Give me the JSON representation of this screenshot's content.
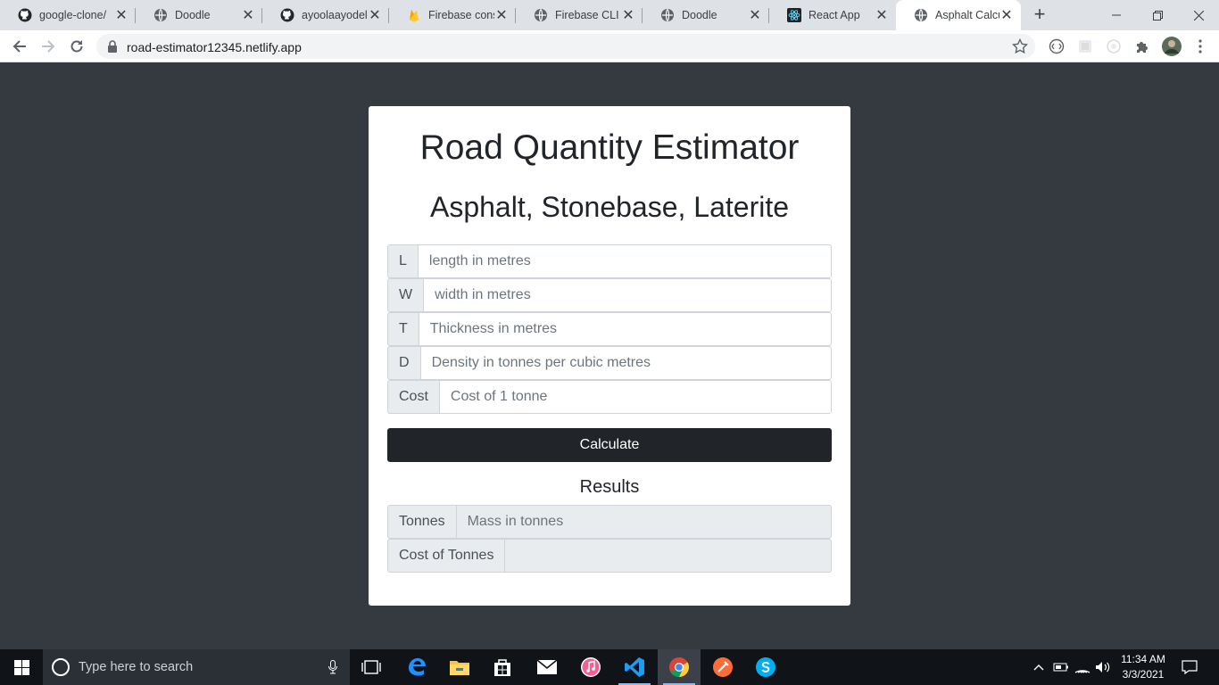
{
  "browser": {
    "tabs": [
      {
        "title": "google-clone/",
        "icon": "github-icon",
        "active": false
      },
      {
        "title": "Doodle",
        "icon": "globe-icon",
        "active": false
      },
      {
        "title": "ayoolaayodele",
        "icon": "github-icon",
        "active": false
      },
      {
        "title": "Firebase conso",
        "icon": "firebase-icon",
        "active": false
      },
      {
        "title": "Firebase CLI",
        "icon": "globe-icon",
        "active": false
      },
      {
        "title": "Doodle",
        "icon": "globe-icon",
        "active": false
      },
      {
        "title": "React App",
        "icon": "react-icon",
        "active": false
      },
      {
        "title": "Asphalt Calcul",
        "icon": "globe-icon",
        "active": true
      }
    ],
    "url": "road-estimator12345.netlify.app"
  },
  "page": {
    "title": "Road Quantity Estimator",
    "subtitle": "Asphalt, Stonebase, Laterite",
    "inputs": [
      {
        "addon": "L",
        "placeholder": "length in metres"
      },
      {
        "addon": "W",
        "placeholder": "width in metres"
      },
      {
        "addon": "T",
        "placeholder": "Thickness in metres"
      },
      {
        "addon": "D",
        "placeholder": "Density in tonnes per cubic metres"
      },
      {
        "addon": "Cost",
        "placeholder": "Cost of 1 tonne"
      }
    ],
    "calculate_label": "Calculate",
    "results_heading": "Results",
    "results": [
      {
        "addon": "Tonnes",
        "placeholder": "Mass in tonnes"
      },
      {
        "addon": "Cost of Tonnes",
        "placeholder": ""
      }
    ]
  },
  "taskbar": {
    "search_placeholder": "Type here to search",
    "time": "11:34 AM",
    "date": "3/3/2021"
  },
  "colors": {
    "page_background": "#343a40",
    "card_background": "#ffffff",
    "button_dark": "#212529",
    "addon_background": "#e9ecef"
  }
}
